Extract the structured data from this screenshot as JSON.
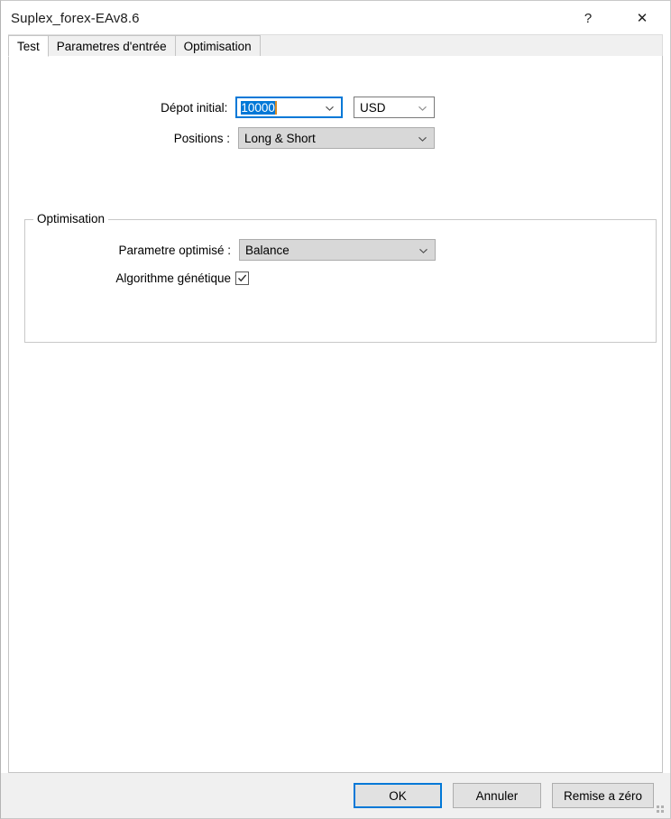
{
  "window": {
    "title": "Suplex_forex-EAv8.6",
    "help_glyph": "?",
    "close_glyph": "✕"
  },
  "tabs": [
    {
      "label": "Test",
      "active": true
    },
    {
      "label": "Parametres d'entrée",
      "active": false
    },
    {
      "label": "Optimisation",
      "active": false
    }
  ],
  "form": {
    "deposit": {
      "label": "Dépot initial:",
      "value": "10000",
      "selected": true
    },
    "currency": {
      "label": "",
      "value": "USD"
    },
    "positions": {
      "label": "Positions :",
      "value": "Long & Short"
    }
  },
  "optimisation_group": {
    "title": "Optimisation",
    "parameter": {
      "label": "Parametre optimisé :",
      "value": "Balance"
    },
    "genetic": {
      "label": "Algorithme génétique",
      "checked": true
    }
  },
  "footer": {
    "ok_label": "OK",
    "cancel_label": "Annuler",
    "reset_label": "Remise a zéro"
  },
  "colors": {
    "accent": "#0078d7",
    "combo_gray": "#d8d8d8",
    "footer_bg": "#f0f0f0",
    "caret": "#d98a22"
  }
}
